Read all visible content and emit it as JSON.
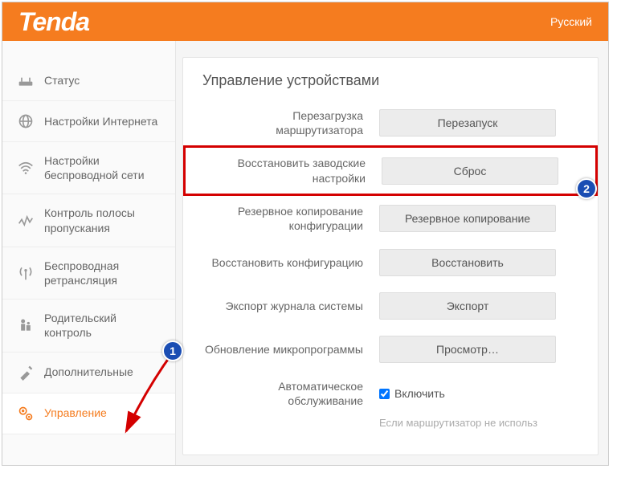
{
  "header": {
    "logo": "Tenda",
    "language": "Русский"
  },
  "sidebar": {
    "items": [
      {
        "label": "Статус"
      },
      {
        "label": "Настройки Интернета"
      },
      {
        "label": "Настройки беспроводной сети"
      },
      {
        "label": "Контроль полосы пропускания"
      },
      {
        "label": "Беспроводная ретрансляция"
      },
      {
        "label": "Родительский контроль"
      },
      {
        "label": "Дополнительные"
      },
      {
        "label": "Управление"
      }
    ]
  },
  "main": {
    "title": "Управление устройствами",
    "rows": [
      {
        "label": "Перезагрузка маршрутизатора",
        "button": "Перезапуск"
      },
      {
        "label": "Восстановить заводские настройки",
        "button": "Сброс"
      },
      {
        "label": "Резервное копирование конфигурации",
        "button": "Резервное копирование"
      },
      {
        "label": "Восстановить конфигурацию",
        "button": "Восстановить"
      },
      {
        "label": "Экспорт журнала системы",
        "button": "Экспорт"
      },
      {
        "label": "Обновление микропрограммы",
        "button": "Просмотр…"
      }
    ],
    "auto_maint_label": "Автоматическое обслуживание",
    "auto_maint_check": "Включить",
    "hint": "Если маршрутизатор не использ"
  },
  "callouts": {
    "one": "1",
    "two": "2"
  }
}
